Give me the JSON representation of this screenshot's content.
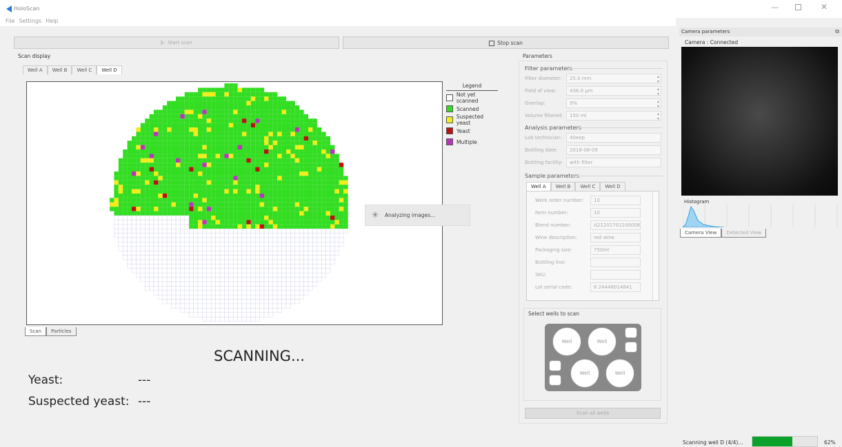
{
  "app": {
    "title": "HoloScan"
  },
  "menu": [
    "File",
    "Settings",
    "Help"
  ],
  "toolbar": {
    "start": "Start scan",
    "stop": "Stop scan"
  },
  "scan_display": {
    "title": "Scan display",
    "tabs": [
      "Well A",
      "Well B",
      "Well C",
      "Well D"
    ],
    "active_tab": 3,
    "bottom_tabs": [
      "Scan",
      "Particles"
    ]
  },
  "legend": {
    "title": "Legend",
    "items": [
      {
        "label": "Not yet scanned",
        "color": "#ffffff"
      },
      {
        "label": "Scanned",
        "color": "#33dd22"
      },
      {
        "label": "Suspected yeast",
        "color": "#f2ec1a"
      },
      {
        "label": "Yeast",
        "color": "#bb1111"
      },
      {
        "label": "Multiple",
        "color": "#bb33bb"
      }
    ]
  },
  "analyzing": "Analyzing images...",
  "status": {
    "headline": "SCANNING...",
    "yeast_label": "Yeast:",
    "yeast_value": "---",
    "suspected_label": "Suspected yeast:",
    "suspected_value": "---"
  },
  "parameters": {
    "title": "Parameters",
    "filter": {
      "title": "Filter parameters",
      "rows": [
        {
          "label": "Filter diameter:",
          "value": "25.0 mm"
        },
        {
          "label": "Field of view:",
          "value": "436.0 µm"
        },
        {
          "label": "Overlap:",
          "value": "9%"
        },
        {
          "label": "Volume filtered:",
          "value": "150 ml"
        }
      ]
    },
    "analysis": {
      "title": "Analysis parameters",
      "rows": [
        {
          "label": "Lab technician:",
          "value": "40eep"
        },
        {
          "label": "Bottling date:",
          "value": "2018-08-09"
        },
        {
          "label": "Bottling facility:",
          "value": "with filter"
        }
      ]
    },
    "sample": {
      "title": "Sample parameters",
      "tabs": [
        "Well A",
        "Well B",
        "Well C",
        "Well D"
      ],
      "rows": [
        {
          "label": "Work order number:",
          "value": "10"
        },
        {
          "label": "Item number:",
          "value": "10"
        },
        {
          "label": "Blend number:",
          "value": "A21201701100008"
        },
        {
          "label": "Wine description:",
          "value": "red wine"
        },
        {
          "label": "Packaging size:",
          "value": "750ml"
        },
        {
          "label": "Bottling line:",
          "value": ""
        },
        {
          "label": "SKU:",
          "value": ""
        },
        {
          "label": "Lot serial code:",
          "value": "6 24448014841"
        }
      ]
    },
    "wells": {
      "title": "Select wells to scan",
      "well_label": "Well",
      "scan_all": "Scan all wells"
    }
  },
  "camera": {
    "panel_title": "Camera parameters",
    "status": "Camera : Connected",
    "histogram": "Histogram",
    "tabs": [
      "Camera View",
      "Detected View"
    ]
  },
  "footer": {
    "status": "Scanning well D (4/4)...",
    "progress": 0.62,
    "percent": "62%"
  }
}
